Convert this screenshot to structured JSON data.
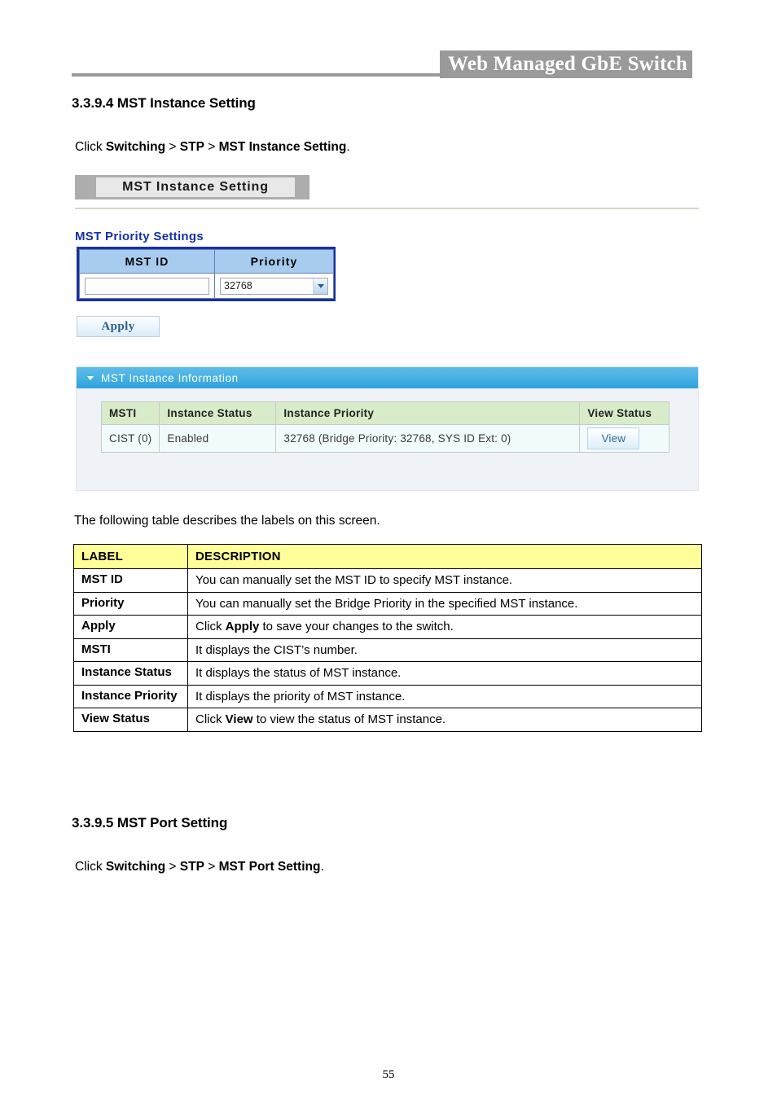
{
  "document": {
    "header_title": "Web Managed GbE Switch",
    "page_number": "55"
  },
  "sections": [
    {
      "heading": "3.3.9.4 MST Instance Setting",
      "click_prefix": "Click ",
      "click_path_1": "Switching",
      "click_sep_1": " > ",
      "click_path_2": "STP",
      "click_sep_2": " > ",
      "click_path_3": "MST Instance Setting",
      "click_suffix": "."
    },
    {
      "heading": "3.3.9.5 MST Port Setting",
      "click_prefix": "Click ",
      "click_path_1": "Switching",
      "click_sep_1": " > ",
      "click_path_2": "STP",
      "click_sep_2": " > ",
      "click_path_3": "MST Port Setting",
      "click_suffix": "."
    }
  ],
  "screenshot": {
    "title_bar": "MST Instance Setting",
    "priority_settings": {
      "legend": "MST Priority Settings",
      "columns": [
        "MST ID",
        "Priority"
      ],
      "mst_id_value": "",
      "mst_id_placeholder": "",
      "priority_selected": "32768",
      "priority_options": [
        "32768"
      ]
    },
    "apply_button": "Apply",
    "instance_information": {
      "panel_title": "MST Instance Information",
      "columns": [
        "MSTI",
        "Instance Status",
        "Instance Priority",
        "View Status"
      ],
      "rows": [
        {
          "msti": "CIST (0)",
          "instance_status": "Enabled",
          "instance_priority": "32768 (Bridge Priority: 32768, SYS ID Ext: 0)",
          "view_button": "View"
        }
      ]
    }
  },
  "describe_line": "The following table describes the labels on this screen.",
  "label_table": {
    "headers": [
      "LABEL",
      "DESCRIPTION"
    ],
    "rows": [
      {
        "label": "MST ID",
        "desc_pre": "You can manually set the MST ID to specify MST instance.",
        "desc_bold": "",
        "desc_post": ""
      },
      {
        "label": "Priority",
        "desc_pre": "You can manually set the Bridge Priority in the specified MST instance.",
        "desc_bold": "",
        "desc_post": ""
      },
      {
        "label": "Apply",
        "desc_pre": "Click ",
        "desc_bold": "Apply",
        "desc_post": " to save your changes to the switch."
      },
      {
        "label": "MSTI",
        "desc_pre": "It displays the CIST’s number.",
        "desc_bold": "",
        "desc_post": ""
      },
      {
        "label": "Instance Status",
        "desc_pre": "It displays the status of MST instance.",
        "desc_bold": "",
        "desc_post": ""
      },
      {
        "label": "Instance Priority",
        "desc_pre": "It displays the priority of MST instance.",
        "desc_bold": "",
        "desc_post": ""
      },
      {
        "label": "View Status",
        "desc_pre": "Click ",
        "desc_bold": "View",
        "desc_post": " to view the status of MST instance."
      }
    ]
  }
}
